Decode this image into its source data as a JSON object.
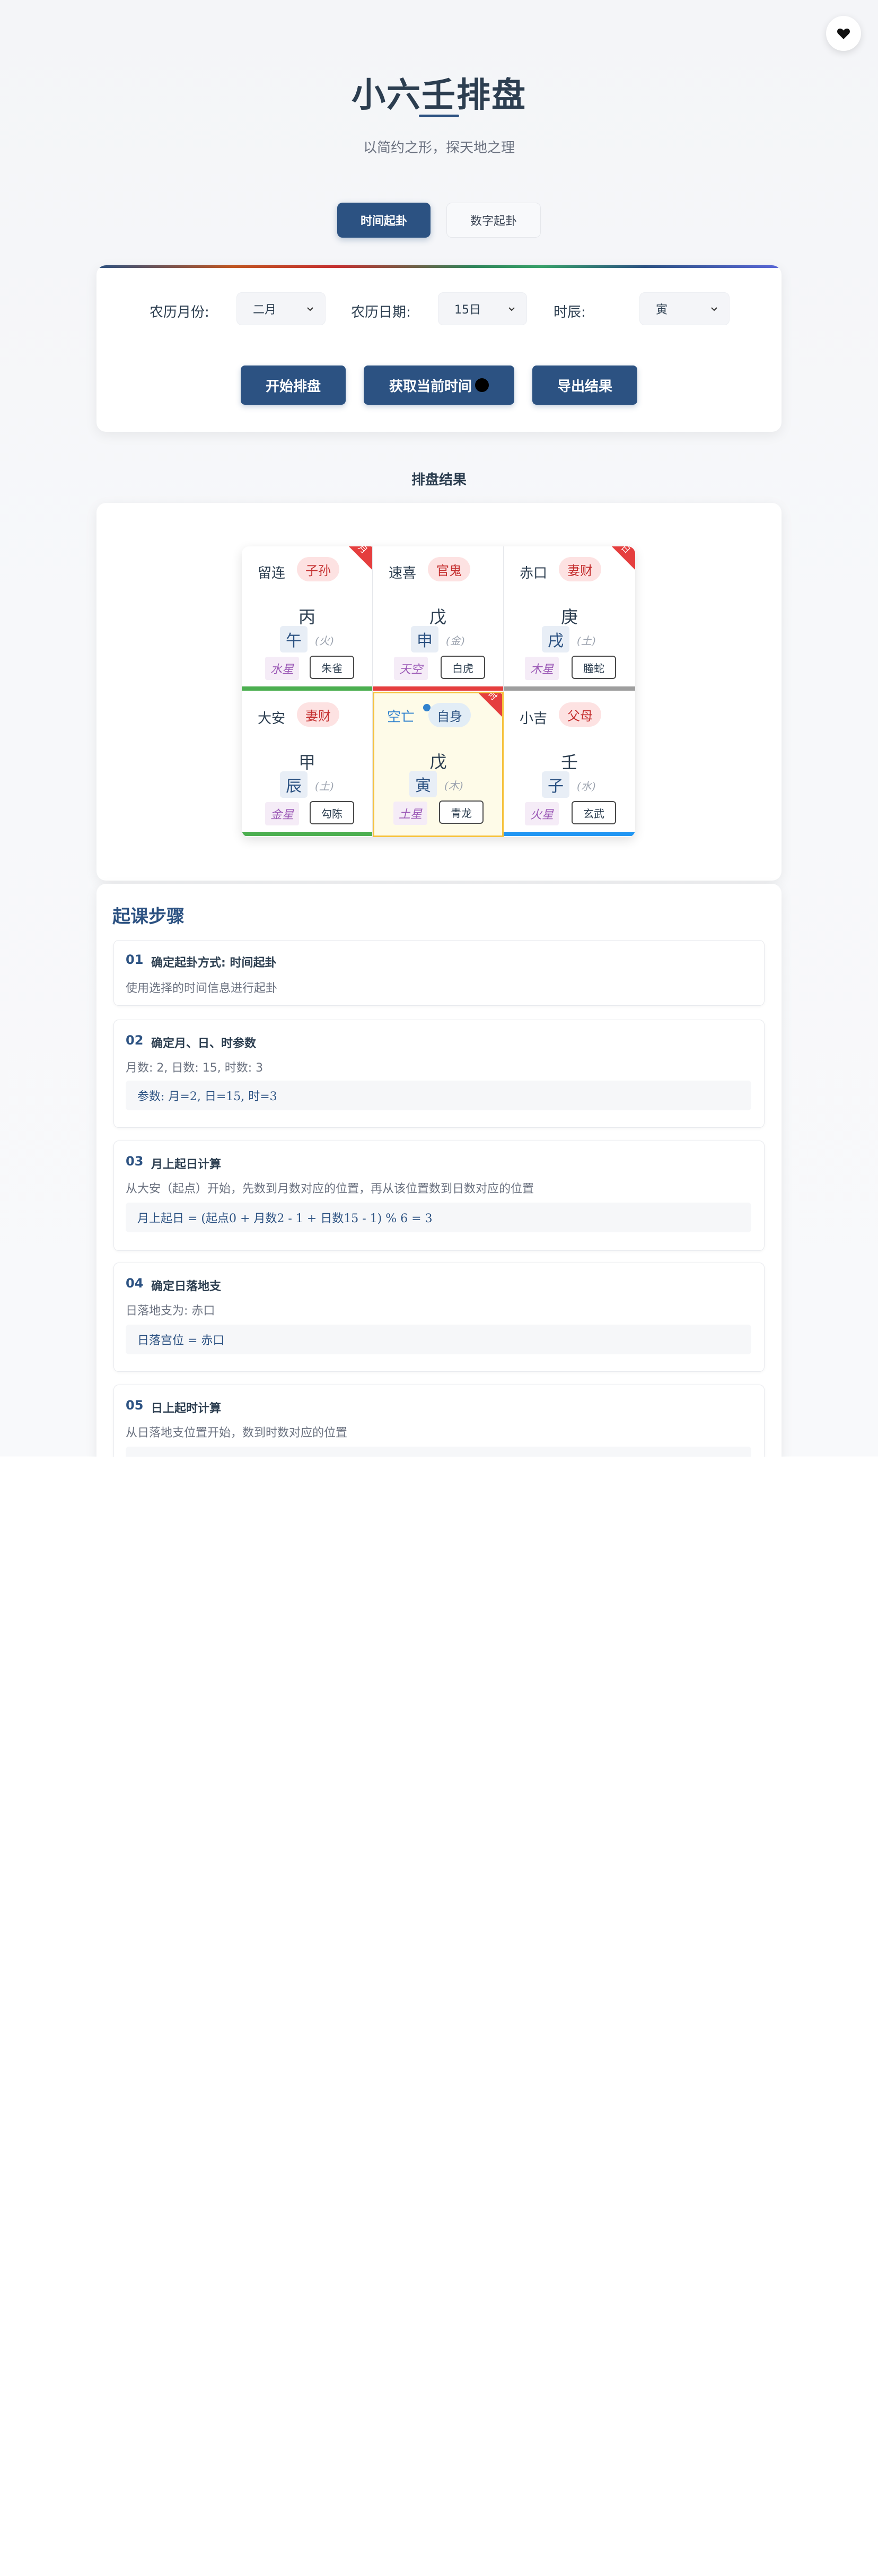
{
  "header": {
    "title": "小六壬排盘",
    "subtitle": "以简约之形，探天地之理"
  },
  "tabs": [
    {
      "label": "时间起卦",
      "active": true
    },
    {
      "label": "数字起卦",
      "active": false
    }
  ],
  "form": {
    "month_label": "农历月份:",
    "month_value": "二月",
    "day_label": "农历日期:",
    "day_value": "15日",
    "hour_label": "时辰:",
    "hour_value": "寅"
  },
  "buttons": {
    "start": "开始排盘",
    "now": "获取当前时间",
    "export": "导出结果"
  },
  "result": {
    "section_title": "排盘结果",
    "cells": [
      {
        "name": "留连",
        "relation": "子孙",
        "stem": "丙",
        "branch": "午",
        "element": "(火)",
        "star": "水星",
        "god": "朱雀",
        "corner": "月",
        "bar_color": "#4caf50"
      },
      {
        "name": "速喜",
        "relation": "官鬼",
        "stem": "戊",
        "branch": "申",
        "element": "(金)",
        "star": "天空",
        "god": "白虎",
        "corner": "",
        "bar_color": "#e53e3e"
      },
      {
        "name": "赤口",
        "relation": "妻财",
        "stem": "庚",
        "branch": "戌",
        "element": "(土)",
        "star": "木星",
        "god": "螣蛇",
        "corner": "日",
        "bar_color": "#9e9e9e"
      },
      {
        "name": "大安",
        "relation": "妻财",
        "stem": "甲",
        "branch": "辰",
        "element": "(土)",
        "star": "金星",
        "god": "勾陈",
        "corner": "",
        "bar_color": "#4caf50"
      },
      {
        "name": "空亡",
        "relation": "自身",
        "stem": "戊",
        "branch": "寅",
        "element": "(木)",
        "star": "土星",
        "god": "青龙",
        "corner": "时",
        "bar_color": "#f6c23e",
        "highlight": true
      },
      {
        "name": "小吉",
        "relation": "父母",
        "stem": "壬",
        "branch": "子",
        "element": "(水)",
        "star": "火星",
        "god": "玄武",
        "corner": "",
        "bar_color": "#2196f3"
      }
    ]
  },
  "steps": {
    "title": "起课步骤",
    "items": [
      {
        "num": "01",
        "heading": "确定起卦方式: 时间起卦",
        "desc": "使用选择的时间信息进行起卦",
        "formula": ""
      },
      {
        "num": "02",
        "heading": "确定月、日、时参数",
        "desc": "月数: 2, 日数: 15, 时数: 3",
        "formula": "参数: 月=2, 日=15, 时=3"
      },
      {
        "num": "03",
        "heading": "月上起日计算",
        "desc": "从大安（起点）开始，先数到月数对应的位置，再从该位置数到日数对应的位置",
        "formula": "月上起日 = (起点0 + 月数2 - 1 + 日数15 - 1) % 6 = 3"
      },
      {
        "num": "04",
        "heading": "确定日落地支",
        "desc": "日落地支为: 赤口",
        "formula": "日落宫位 = 赤口"
      },
      {
        "num": "05",
        "heading": "日上起时计算",
        "desc": "从日落地支位置开始，数到时数对应的位置",
        "formula": ""
      }
    ]
  },
  "icons": {
    "heart": "heart-icon",
    "select_arrow": "chevron-down-icon",
    "moon": "moon-icon"
  }
}
